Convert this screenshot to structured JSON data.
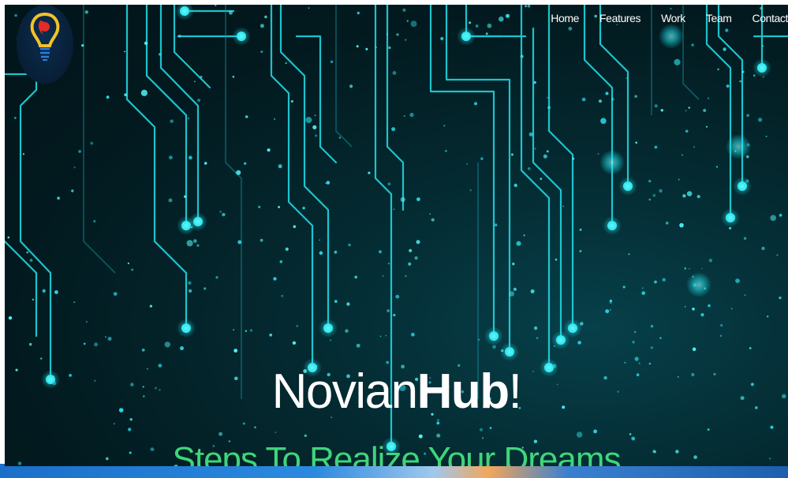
{
  "nav": {
    "items": [
      {
        "label": "Home"
      },
      {
        "label": "Features"
      },
      {
        "label": "Work"
      },
      {
        "label": "Team"
      },
      {
        "label": "Contact"
      }
    ]
  },
  "hero": {
    "title_regular": "Novian",
    "title_bold": "Hub",
    "title_suffix": "!",
    "subtitle": "Steps To Realize Your Dreams"
  },
  "logo": {
    "icon": "lightbulb-logo-icon"
  },
  "colors": {
    "background": "#021a1f",
    "circuit": "#1fd6e0",
    "subtitle": "#3fd67a",
    "nav_text": "#ffffff"
  }
}
